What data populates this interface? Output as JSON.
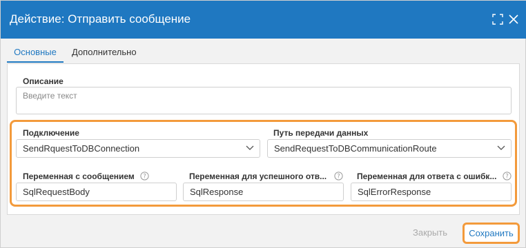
{
  "dialog": {
    "title": "Действие: Отправить сообщение"
  },
  "icons": {
    "maximize": "maximize-icon",
    "close": "close-icon",
    "help": "question-circle-icon",
    "dropdown": "chevron-down-icon"
  },
  "tabs": [
    {
      "label": "Основные",
      "active": true
    },
    {
      "label": "Дополнительно",
      "active": false
    }
  ],
  "form": {
    "description": {
      "label": "Описание",
      "placeholder": "Введите текст",
      "value": ""
    },
    "connection": {
      "label": "Подключение",
      "value": "SendRquestToDBConnection"
    },
    "route": {
      "label": "Путь передачи данных",
      "value": "SendRequestToDBCommunicationRoute"
    },
    "message_var": {
      "label": "Переменная с сообщением",
      "value": "SqlRequestBody"
    },
    "success_var": {
      "label": "Переменная для успешного отв...",
      "value": "SqlResponse"
    },
    "error_var": {
      "label": "Переменная для ответа с ошибк...",
      "value": "SqlErrorResponse"
    }
  },
  "footer": {
    "close_label": "Закрыть",
    "save_label": "Сохранить"
  },
  "colors": {
    "accent": "#1f78c1",
    "highlight": "#f39a3b"
  }
}
